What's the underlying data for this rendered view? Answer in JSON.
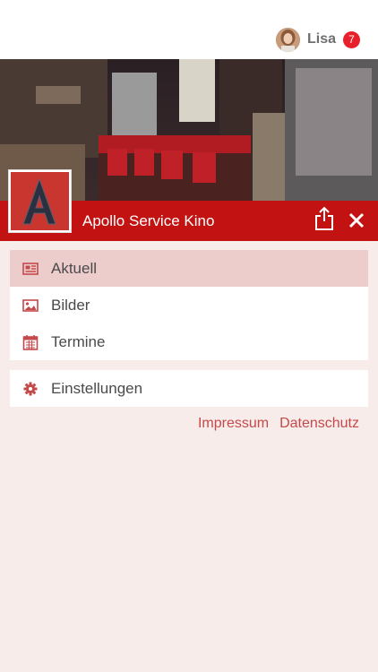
{
  "user": {
    "name": "Lisa",
    "notification_count": "7"
  },
  "cinema": {
    "name": "Apollo Service Kino",
    "logo_letter": "A"
  },
  "menu": {
    "items": [
      {
        "label": "Aktuell",
        "icon": "newspaper-icon"
      },
      {
        "label": "Bilder",
        "icon": "image-icon"
      },
      {
        "label": "Termine",
        "icon": "calendar-icon"
      }
    ],
    "settings": {
      "label": "Einstellungen",
      "icon": "gear-icon"
    }
  },
  "footer": {
    "impressum": "Impressum",
    "datenschutz": "Datenschutz"
  },
  "colors": {
    "brand_red": "#c21312",
    "accent_link": "#c4494a",
    "background": "#f8eceb",
    "active_item": "#edcdcc",
    "badge": "#e8202a"
  }
}
